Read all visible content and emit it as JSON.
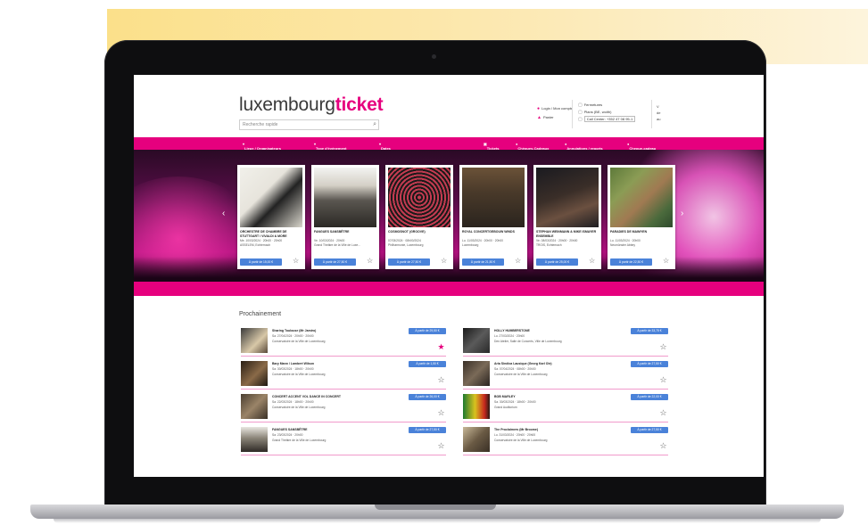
{
  "colors": {
    "brand": "#e6007e",
    "button": "#4a82d9",
    "accent_bar": "#fbe08a"
  },
  "site": {
    "logo_main": "luxembourg",
    "logo_brand": "ticket",
    "search_placeholder": "Recherche rapide",
    "search_icon": "search-icon"
  },
  "header": {
    "user_links": [
      "Login / Mon compte",
      "Panier"
    ],
    "contact": [
      "Fermetures",
      "Plans (BE, wolth)",
      "Call Center: +352 47 08 95-1"
    ],
    "contact_more": [
      "V",
      "de",
      "au"
    ]
  },
  "nav": {
    "left": [
      "Lieux / Organisateurs",
      "Type d'événement",
      "Dates"
    ],
    "right": [
      "Tickets",
      "Chèques-Cadeaux",
      "Annulations / reports",
      "Cheque-cadeau"
    ]
  },
  "featured": [
    {
      "title": "ORCHESTRE DE CHAMBRE DE STUTTGART / VIVALDI & MORE",
      "date": "Me. 10/03/2024 · 20h00 · 20h00",
      "venue": "ASSELEM, Echternach",
      "button": "À partir de 15,00 €",
      "star": false
    },
    {
      "title": "FANGUES SANSBÊTRE",
      "date": "Ve. 10/03/2024 · 20h00",
      "venue": "Grand Théâtre de la Ville de Luxe...",
      "button": "À partir de 27,50 €",
      "star": false
    },
    {
      "title": "COSMOSNOT (GROOVE)",
      "date": "07/03/2024 · 08h00/2024",
      "venue": "Philharmonie, Luxembourg",
      "button": "À partir de 27,50 €",
      "star": false
    },
    {
      "title": "ROYAL CONCERTGEBOUW WINDS",
      "date": "Lu. 11/03/2024 · 20h00 · 20h00",
      "venue": "Luxembourg",
      "button": "À partir de 21,50 €",
      "star": false
    },
    {
      "title": "STEPHAN WEINMANN & MIKE ISMAYER ENSEMBLE",
      "date": "Ve. 08/03/2024 · 20h00 · 20h00",
      "venue": "TROIS, Echternach",
      "button": "À partir de 25,00 €",
      "star": false
    },
    {
      "title": "PARADIES DE MAIMYEN",
      "date": "Lu. 11/03/2024 · 20h00",
      "venue": "Neumünster Abbey",
      "button": "À partir de 22,50 €",
      "star": false
    }
  ],
  "upcoming": {
    "title": "Prochainement",
    "items": [
      {
        "title": "Sharing Toulouse (Mr Jamiro)",
        "date": "Sa. 27/04/2024 · 20h00 · 20h00",
        "venue": "Conservatoire de la Ville de Luxembourg",
        "button": "À partir de 29,50 €",
        "star": true
      },
      {
        "title": "HOLLY HUMBERSTONE",
        "date": "Lu. 27/03/2024 · 20h00",
        "venue": "Den Atelier, Salle de Concerts, Ville de Luxembourg",
        "button": "À partir de 33,75 €",
        "star": false
      },
      {
        "title": "Bary Mann / Lambert Wilson",
        "date": "Sa. 30/03/2024 · 18h00 · 20h00",
        "venue": "Conservatoire de la Ville de Luxembourg",
        "button": "À partir de 1,50 €",
        "star": false
      },
      {
        "title": "Aria Sindica Lausique (Georg Karl Ole)",
        "date": "Sa. 07/04/2024 · 08h00 · 20h00",
        "venue": "Conservatoire de la Ville de Luxembourg",
        "button": "À partir de 27,50 €",
        "star": false
      },
      {
        "title": "CONCERT ACCENT VOL DANCE IN CONCERT",
        "date": "Sa. 22/03/2024 · 18h00 · 20h00",
        "venue": "Conservatoire de la Ville de Luxembourg",
        "button": "À partir de 26,00 €",
        "star": false
      },
      {
        "title": "BOB MARLEY",
        "date": "Sa. 30/03/2024 · 18h00 · 20h00",
        "venue": "Grand Auditorium",
        "button": "À partir de 22,00 €",
        "star": false
      },
      {
        "title": "FANGUES SANSBÊTRE",
        "date": "Sa. 23/03/2024 · 20h00",
        "venue": "Grand Théâtre de la Ville de Luxembourg",
        "button": "À partir de 27,50 €",
        "star": false
      },
      {
        "title": "The Proclaimers (Mr Broome)",
        "date": "Lu. 31/03/2024 · 20h00 · 20h00",
        "venue": "Conservatoire de la Ville de Luxembourg",
        "button": "À partir de 27,50 €",
        "star": false
      }
    ]
  }
}
